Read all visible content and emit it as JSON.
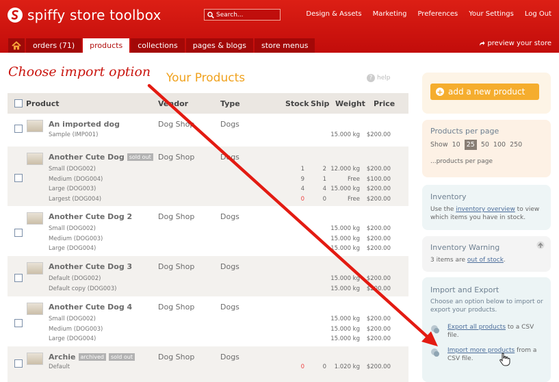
{
  "app": {
    "title": "spiffy store toolbox"
  },
  "search": {
    "placeholder": "Search..."
  },
  "topnav": [
    "Design & Assets",
    "Marketing",
    "Preferences",
    "Your Settings",
    "Log Out"
  ],
  "tabs": [
    {
      "label": "orders (71)"
    },
    {
      "label": "products"
    },
    {
      "label": "collections"
    },
    {
      "label": "pages & blogs"
    },
    {
      "label": "store menus"
    }
  ],
  "preview": "preview your store",
  "annotation": "Choose import option",
  "page_title": "Your Products",
  "help": "help",
  "headers": {
    "product": "Product",
    "vendor": "Vendor",
    "type": "Type",
    "stock": "Stock",
    "ship": "Ship",
    "weight": "Weight",
    "price": "Price"
  },
  "products": [
    {
      "name": "An imported dog",
      "badges": [],
      "vendor": "Dog Shop",
      "type": "Dogs",
      "variants": [
        {
          "label": "Sample (IMP001)",
          "stock": "",
          "ship": "",
          "weight": "15.000 kg",
          "price": "$200.00"
        }
      ]
    },
    {
      "name": "Another Cute Dog",
      "badges": [
        "sold out"
      ],
      "vendor": "Dog Shop",
      "type": "Dogs",
      "variants": [
        {
          "label": "Small (DOG002)",
          "stock": "1",
          "ship": "2",
          "weight": "12.000 kg",
          "price": "$200.00"
        },
        {
          "label": "Medium (DOG004)",
          "stock": "9",
          "ship": "1",
          "weight": "Free",
          "price": "$100.00"
        },
        {
          "label": "Large (DOG003)",
          "stock": "4",
          "ship": "4",
          "weight": "15.000 kg",
          "price": "$200.00"
        },
        {
          "label": "Largest (DOG004)",
          "stock": "0",
          "ship": "0",
          "weight": "Free",
          "price": "$200.00"
        }
      ]
    },
    {
      "name": "Another Cute Dog 2",
      "badges": [],
      "vendor": "Dog Shop",
      "type": "Dogs",
      "variants": [
        {
          "label": "Small (DOG002)",
          "stock": "",
          "ship": "",
          "weight": "15.000 kg",
          "price": "$200.00"
        },
        {
          "label": "Medium (DOG003)",
          "stock": "",
          "ship": "",
          "weight": "15.000 kg",
          "price": "$200.00"
        },
        {
          "label": "Large (DOG004)",
          "stock": "",
          "ship": "",
          "weight": "15.000 kg",
          "price": "$200.00"
        }
      ]
    },
    {
      "name": "Another Cute Dog 3",
      "badges": [],
      "vendor": "Dog Shop",
      "type": "Dogs",
      "variants": [
        {
          "label": "Default (DOG002)",
          "stock": "",
          "ship": "",
          "weight": "15.000 kg",
          "price": "$200.00"
        },
        {
          "label": "Default copy (DOG003)",
          "stock": "",
          "ship": "",
          "weight": "15.000 kg",
          "price": "$200.00"
        }
      ]
    },
    {
      "name": "Another Cute Dog 4",
      "badges": [],
      "vendor": "Dog Shop",
      "type": "Dogs",
      "variants": [
        {
          "label": "Small (DOG002)",
          "stock": "",
          "ship": "",
          "weight": "15.000 kg",
          "price": "$200.00"
        },
        {
          "label": "Medium (DOG003)",
          "stock": "",
          "ship": "",
          "weight": "15.000 kg",
          "price": "$200.00"
        },
        {
          "label": "Large (DOG004)",
          "stock": "",
          "ship": "",
          "weight": "15.000 kg",
          "price": "$200.00"
        }
      ]
    },
    {
      "name": "Archie",
      "badges": [
        "archived",
        "sold out"
      ],
      "vendor": "Dog Shop",
      "type": "Dogs",
      "variants": [
        {
          "label": "Default",
          "stock": "0",
          "ship": "0",
          "weight": "1.020 kg",
          "price": "$200.00"
        }
      ]
    }
  ],
  "sidebar": {
    "add_product": "add a new product",
    "per_page": {
      "title": "Products per page",
      "show": "Show",
      "options": [
        "10",
        "25",
        "50",
        "100",
        "250"
      ],
      "selected": "25",
      "suffix": "...products per page"
    },
    "inventory": {
      "title": "Inventory",
      "text_pre": "Use the ",
      "link": "inventory overview",
      "text_post": " to view which items you have in stock."
    },
    "warning": {
      "title": "Inventory Warning",
      "text_pre": "3 items are ",
      "link": "out of stock",
      "text_post": "."
    },
    "import_export": {
      "title": "Import and Export",
      "desc": "Choose an option below to import or export your products.",
      "export_link": "Export all products",
      "export_tail": " to a CSV file.",
      "import_link": "Import more products",
      "import_tail": " from a CSV file."
    }
  },
  "colors": {
    "brand": "#d0100e",
    "accent": "#f0a21e",
    "annotation": "#c9140e"
  }
}
